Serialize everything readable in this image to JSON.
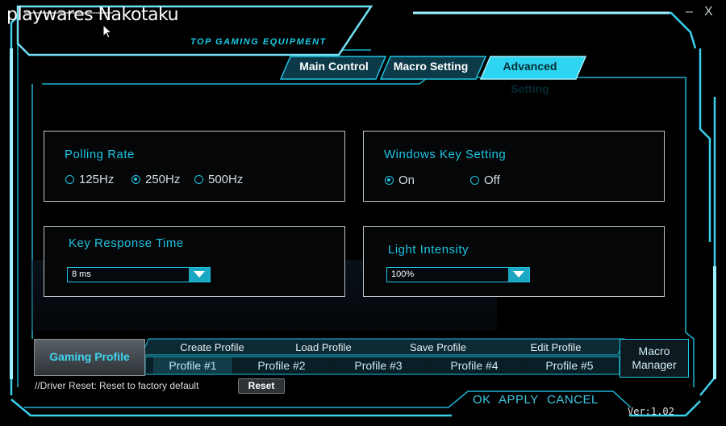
{
  "brand": {
    "name": "playwares Nakotaku",
    "tagline": "TOP GAMING EQUIPMENT"
  },
  "window": {
    "minimize": "–",
    "close": "X"
  },
  "tabs": [
    {
      "label": "Main Control",
      "active": false
    },
    {
      "label": "Macro Setting",
      "active": false
    },
    {
      "label": "Advanced Setting",
      "active": true
    }
  ],
  "polling": {
    "title": "Polling Rate",
    "options": [
      {
        "label": "125Hz",
        "selected": false
      },
      {
        "label": "250Hz",
        "selected": true
      },
      {
        "label": "500Hz",
        "selected": false
      }
    ]
  },
  "winkey": {
    "title": "Windows Key Setting",
    "options": [
      {
        "label": "On",
        "selected": true
      },
      {
        "label": "Off",
        "selected": false
      }
    ]
  },
  "response": {
    "title": "Key Response Time",
    "value": "8 ms"
  },
  "light": {
    "title": "Light Intensity",
    "value": "100%"
  },
  "profile_bar": {
    "gaming_profile": "Gaming Profile",
    "actions": [
      "Create Profile",
      "Load Profile",
      "Save Profile",
      "Edit Profile"
    ],
    "profiles": [
      "Profile #1",
      "Profile #2",
      "Profile #3",
      "Profile #4",
      "Profile #5"
    ],
    "selected_index": 0,
    "macro_manager": [
      "Macro",
      "Manager"
    ]
  },
  "footer": {
    "driver_reset_text": "//Driver Reset: Reset to factory default",
    "reset_label": "Reset",
    "ok": "OK",
    "apply": "APPLY",
    "cancel": "CANCEL",
    "version": "Ver:1.02"
  },
  "colors": {
    "accent": "#1fc4e2",
    "frame": "#7fdcef",
    "background": "#000000"
  },
  "icons": {
    "cursor": "arrow-cursor-icon",
    "dropdown": "triangle-down-icon"
  }
}
